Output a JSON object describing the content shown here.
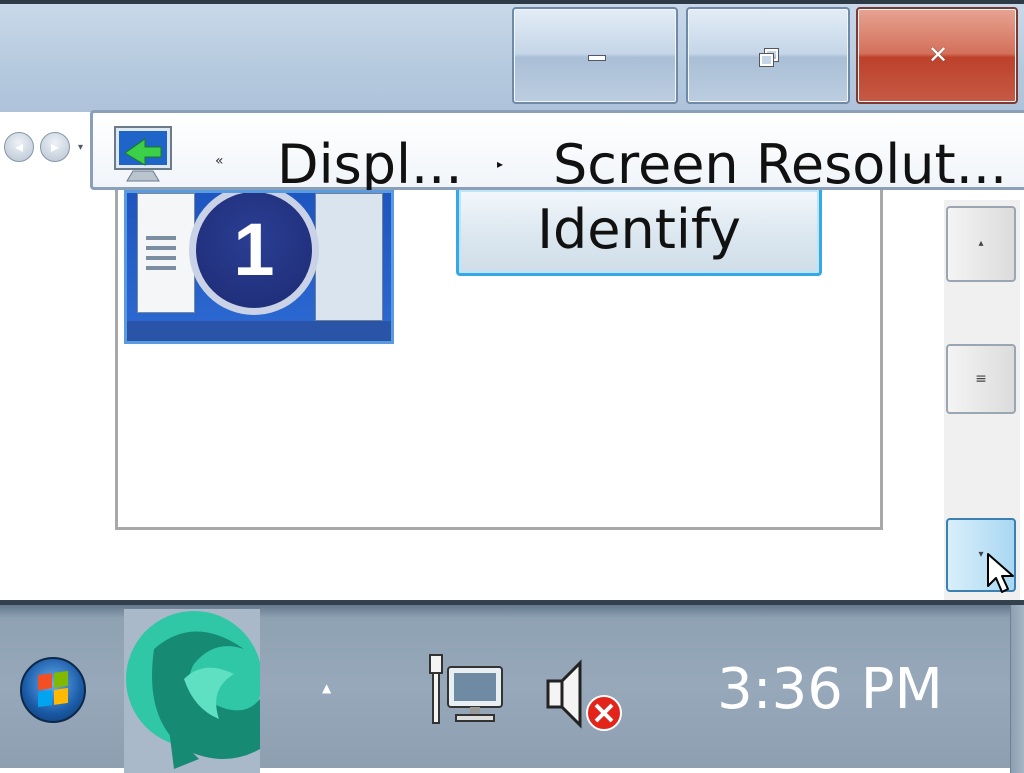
{
  "window": {
    "caption_buttons": {
      "minimize": "minimize",
      "restore": "restore",
      "close": "close"
    }
  },
  "address_bar": {
    "overflow_chevron": "«",
    "breadcrumbs": [
      "Displ...",
      "Screen Resolut..."
    ],
    "separator": "▸"
  },
  "content": {
    "monitor_number": "1",
    "identify_button": "Identify"
  },
  "scrollbar": {
    "up_arrow": "▴",
    "thumb_grip": "≡",
    "down_arrow": "▾"
  },
  "taskbar": {
    "tray_expander": "▲",
    "clock": "3:36 PM"
  },
  "colors": {
    "close_button": "#c65a45",
    "selection_accent": "#37a8e6",
    "taskbar": "#96a8ba"
  },
  "icons": [
    "back-icon",
    "forward-icon",
    "display-monitor-icon",
    "windows-start-icon",
    "network-icon",
    "volume-muted-icon",
    "mouse-cursor-icon"
  ]
}
